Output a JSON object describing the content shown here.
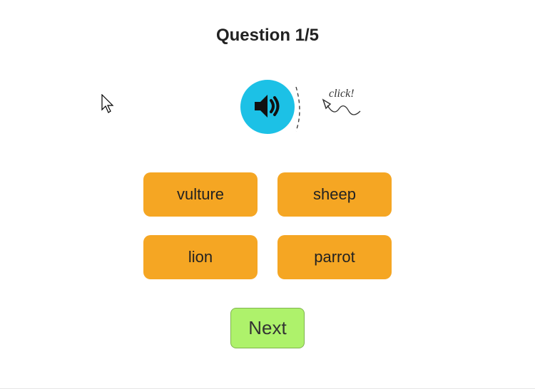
{
  "title": "Question 1/5",
  "hint": "click!",
  "options": [
    "vulture",
    "sheep",
    "lion",
    "parrot"
  ],
  "next_label": "Next",
  "colors": {
    "accent": "#1cc1e6",
    "option": "#f5a623",
    "next": "#aef26b"
  }
}
